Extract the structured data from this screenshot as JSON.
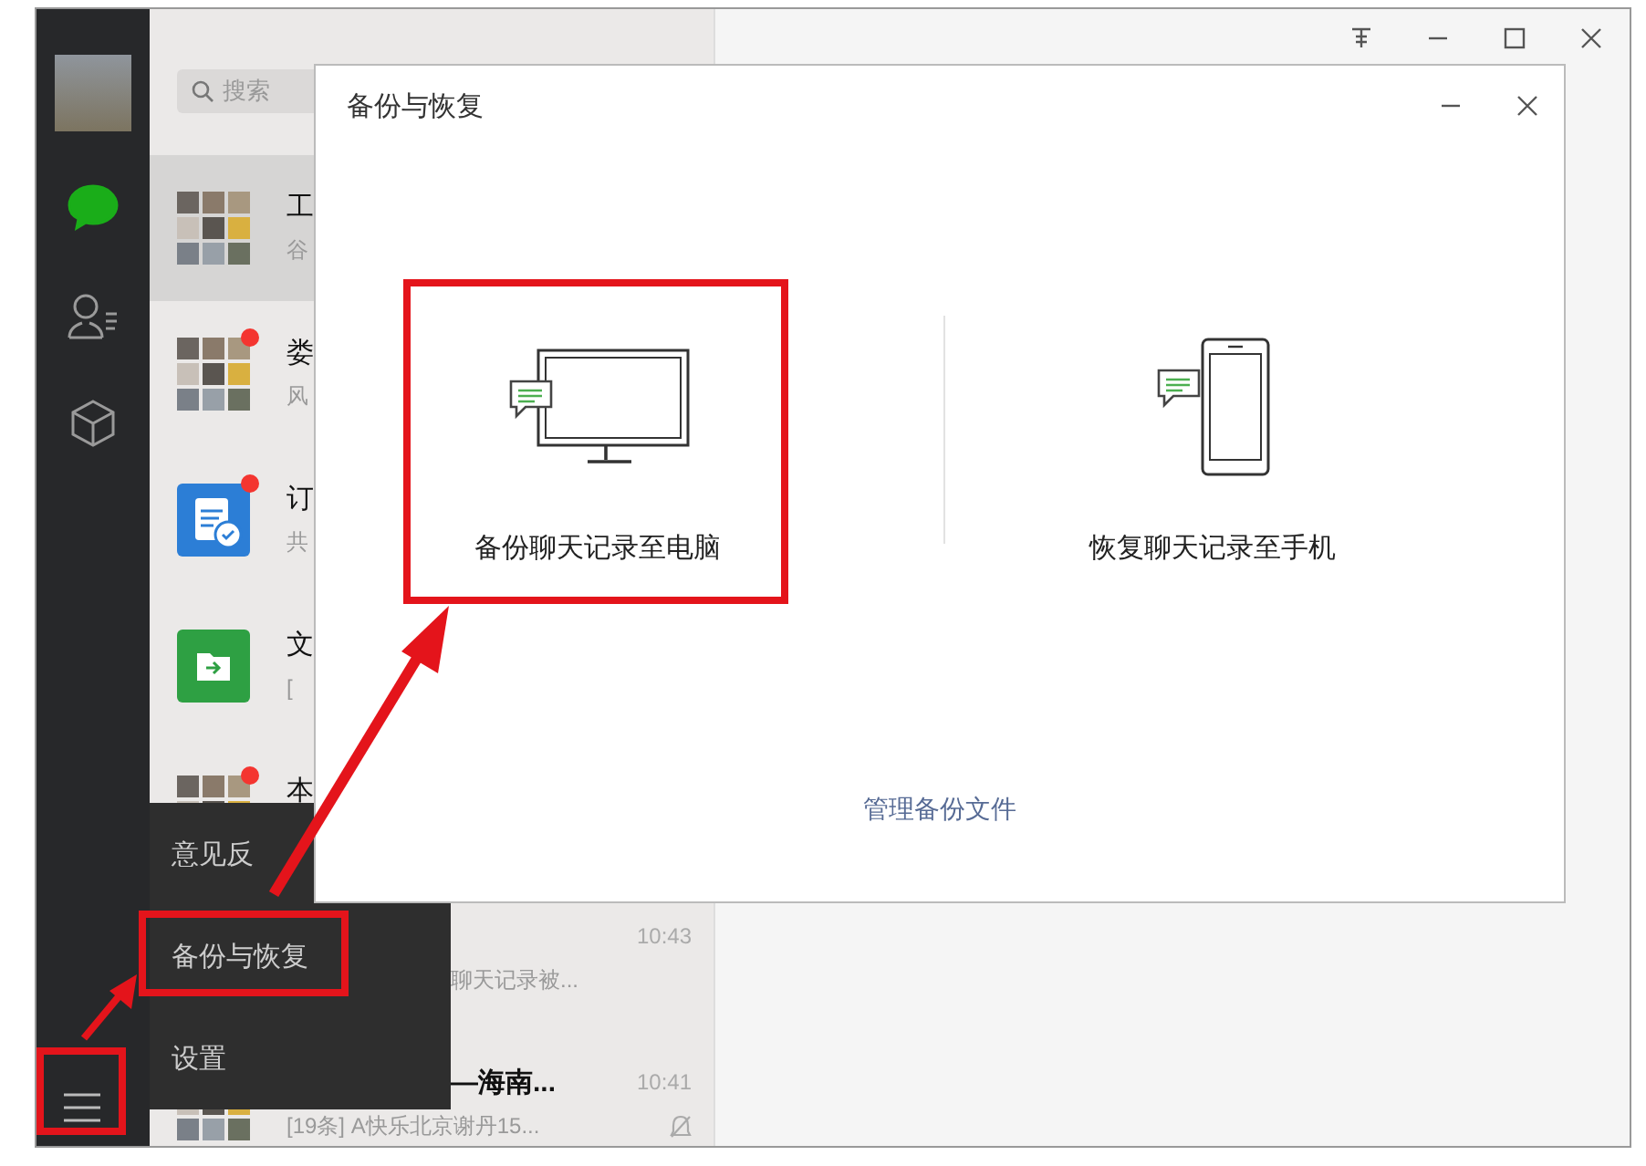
{
  "sidebar": {
    "nav": [
      {
        "kind": "chats",
        "selected": true
      },
      {
        "kind": "contacts",
        "selected": false
      },
      {
        "kind": "favorites",
        "selected": false
      }
    ]
  },
  "search": {
    "placeholder": "搜索"
  },
  "chats": [
    {
      "kind": "group",
      "title": "工",
      "preview": "谷",
      "selected": true,
      "unread": false
    },
    {
      "kind": "group",
      "title": "娄",
      "preview": "风",
      "selected": false,
      "unread": true
    },
    {
      "kind": "doc",
      "title": "订",
      "preview": "共",
      "selected": false,
      "unread": true
    },
    {
      "kind": "folder",
      "title": "文",
      "preview": "[",
      "selected": false,
      "unread": false
    },
    {
      "kind": "group",
      "title": "本",
      "selected": false,
      "unread": true
    },
    {
      "time": "10:43",
      "preview": "聊天记录被...",
      "selected": false,
      "unread": false
    },
    {
      "kind": "group",
      "title": "—海南...",
      "time": "10:41",
      "preview": "[19条] A快乐北京谢丹15...",
      "selected": false,
      "unread": false,
      "muted": true
    }
  ],
  "menu": {
    "items": [
      "意见反",
      "备份与恢复",
      "设置"
    ]
  },
  "dialog": {
    "title": "备份与恢复",
    "options": [
      {
        "kind": "computer",
        "label": "备份聊天记录至电脑"
      },
      {
        "kind": "phone",
        "label": "恢复聊天记录至手机"
      }
    ],
    "link": "管理备份文件"
  }
}
